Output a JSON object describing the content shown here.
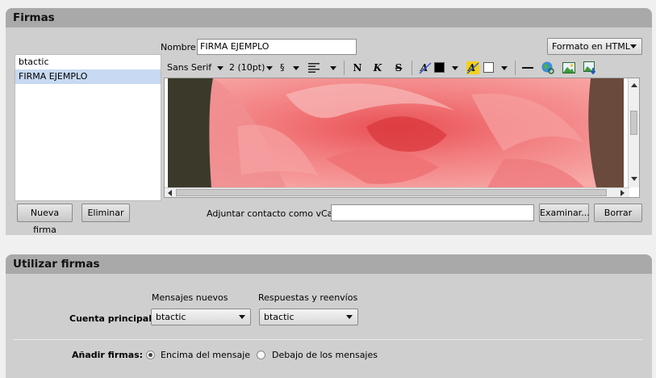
{
  "firmas": {
    "title": "Firmas",
    "nombre_label": "Nombre:",
    "nombre_value": "FIRMA EJEMPLO",
    "formato_select": "Formato en HTML",
    "signature_list": [
      "btactic",
      "FIRMA EJEMPLO"
    ],
    "selected_index": 1,
    "toolbar": {
      "font_family": "Sans Serif",
      "font_size": "2 (10pt)",
      "paragraph_symbol": "§",
      "bold": "N",
      "italic": "K",
      "strike": "S",
      "font_color": "#000000",
      "highlight_color": "#ffffff"
    },
    "nueva_firma_button": "Nueva firma",
    "eliminar_button": "Eliminar",
    "vcard_label": "Adjuntar contacto como vCard:",
    "vcard_value": "",
    "examinar_button": "Examinar...",
    "borrar_button": "Borrar"
  },
  "utilizar": {
    "title": "Utilizar firmas",
    "col_nuevos": "Mensajes nuevos",
    "col_respuestas": "Respuestas y reenvíos",
    "cuenta_label": "Cuenta principal:",
    "cuenta_nuevos_value": "btactic",
    "cuenta_respuestas_value": "btactic",
    "anadir_label": "Añadir firmas:",
    "option_encima": "Encima del mensaje",
    "option_debajo": "Debajo de los mensajes",
    "selected_option": "Encima del mensaje"
  },
  "colors": {
    "panel_bg": "#cfcfcf",
    "header_bg": "#a9a9a9",
    "selection": "#c7d9f3"
  }
}
